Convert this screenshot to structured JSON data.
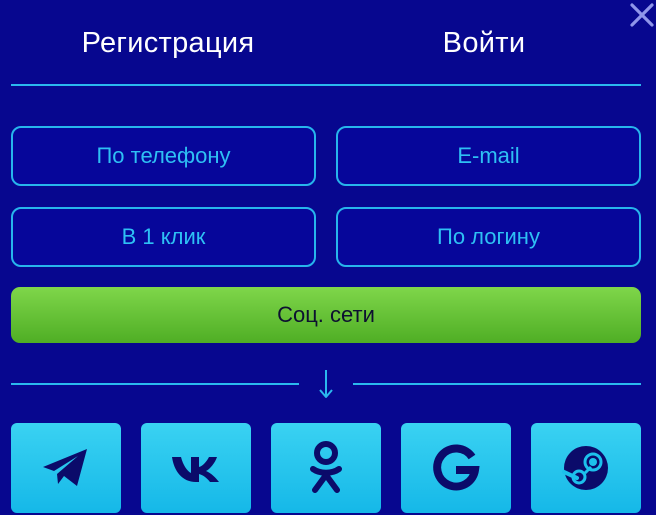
{
  "tabs": {
    "register": "Регистрация",
    "login": "Войти"
  },
  "options": {
    "phone": "По телефону",
    "email": "E-mail",
    "one_click": "В 1 клик",
    "by_login": "По логину",
    "social": "Соц. сети"
  },
  "social_networks": [
    "telegram-icon",
    "vk-icon",
    "odnoklassniki-icon",
    "google-icon",
    "steam-icon"
  ],
  "colors": {
    "background": "#07078f",
    "accent": "#2bb8ee",
    "green": "#5fbf30",
    "icon_tile": "#1cc0ec",
    "icon_glyph": "#0b0b6a"
  }
}
